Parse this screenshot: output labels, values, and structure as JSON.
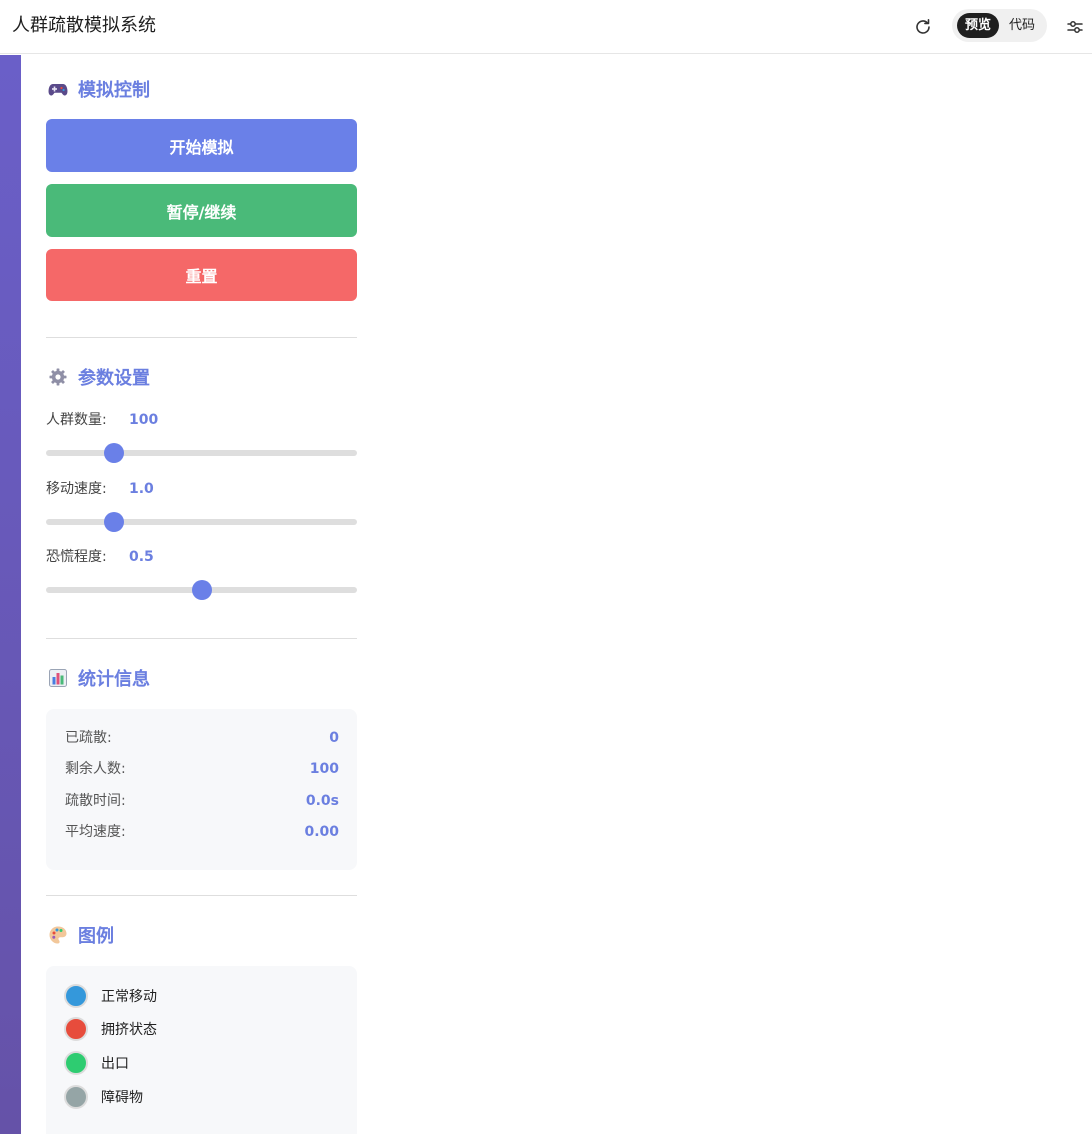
{
  "header": {
    "title": "人群疏散模拟系统",
    "view_toggle": {
      "preview_label": "预览",
      "code_label": "代码",
      "selected": "预览"
    },
    "icons": {
      "refresh": "refresh-icon",
      "settings": "sliders-icon"
    }
  },
  "controls": {
    "title": "模拟控制",
    "icon": "gamepad-icon",
    "start_label": "开始模拟",
    "pause_label": "暂停/继续",
    "reset_label": "重置",
    "colors": {
      "start": "#6a80e8",
      "pause": "#4aba79",
      "reset": "#f56868"
    }
  },
  "params": {
    "title": "参数设置",
    "icon": "gear-icon",
    "items": [
      {
        "label": "人群数量:",
        "value": "100",
        "fraction": 0.22
      },
      {
        "label": "移动速度:",
        "value": "1.0",
        "fraction": 0.22
      },
      {
        "label": "恐慌程度:",
        "value": "0.5",
        "fraction": 0.5
      }
    ]
  },
  "stats": {
    "title": "统计信息",
    "icon": "bar-chart-icon",
    "rows": [
      {
        "label": "已疏散:",
        "value": "0"
      },
      {
        "label": "剩余人数:",
        "value": "100"
      },
      {
        "label": "疏散时间:",
        "value": "0.0s"
      },
      {
        "label": "平均速度:",
        "value": "0.00"
      }
    ]
  },
  "legend": {
    "title": "图例",
    "icon": "palette-icon",
    "items": [
      {
        "label": "正常移动",
        "color": "#3498db"
      },
      {
        "label": "拥挤状态",
        "color": "#e74c3c"
      },
      {
        "label": "出口",
        "color": "#2ecc71"
      },
      {
        "label": "障碍物",
        "color": "#95a5a6"
      }
    ]
  },
  "accent_color": "#6b7fe0"
}
